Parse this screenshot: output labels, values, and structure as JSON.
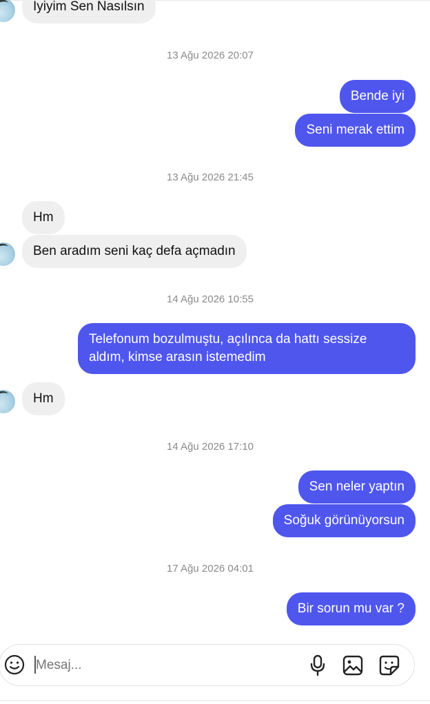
{
  "messages": [
    {
      "id": "m1",
      "text": "Iyiyim Sen Nasılsın"
    },
    {
      "id": "t1",
      "time": "13 Ağu 2026 20:07"
    },
    {
      "id": "m2",
      "text": "Bende iyi"
    },
    {
      "id": "m3",
      "text": "Seni merak ettim"
    },
    {
      "id": "t2",
      "time": "13 Ağu 2026 21:45"
    },
    {
      "id": "m4",
      "text": "Hm"
    },
    {
      "id": "m5",
      "text": "Ben aradım seni kaç defa açmadın"
    },
    {
      "id": "t3",
      "time": "14 Ağu 2026 10:55"
    },
    {
      "id": "m6",
      "text": "Telefonum bozulmuştu, açılınca da hattı sessize aldım, kimse arasın istemedim"
    },
    {
      "id": "m7",
      "text": "Hm"
    },
    {
      "id": "t4",
      "time": "14 Ağu 2026 17:10"
    },
    {
      "id": "m8",
      "text": "Sen neler yaptın"
    },
    {
      "id": "m9",
      "text": "Soğuk görünüyorsun"
    },
    {
      "id": "t5",
      "time": "17 Ağu 2026 04:01"
    },
    {
      "id": "m10",
      "text": "Bir sorun mu var ?"
    }
  ],
  "composer": {
    "placeholder": "Mesaj...",
    "icons": [
      "emoji-icon",
      "microphone-icon",
      "gallery-icon",
      "sticker-icon"
    ]
  },
  "colors": {
    "outgoing_bubble": "#4f56ee",
    "incoming_bubble": "#efefef",
    "timestamp_text": "#8a8a8a"
  }
}
